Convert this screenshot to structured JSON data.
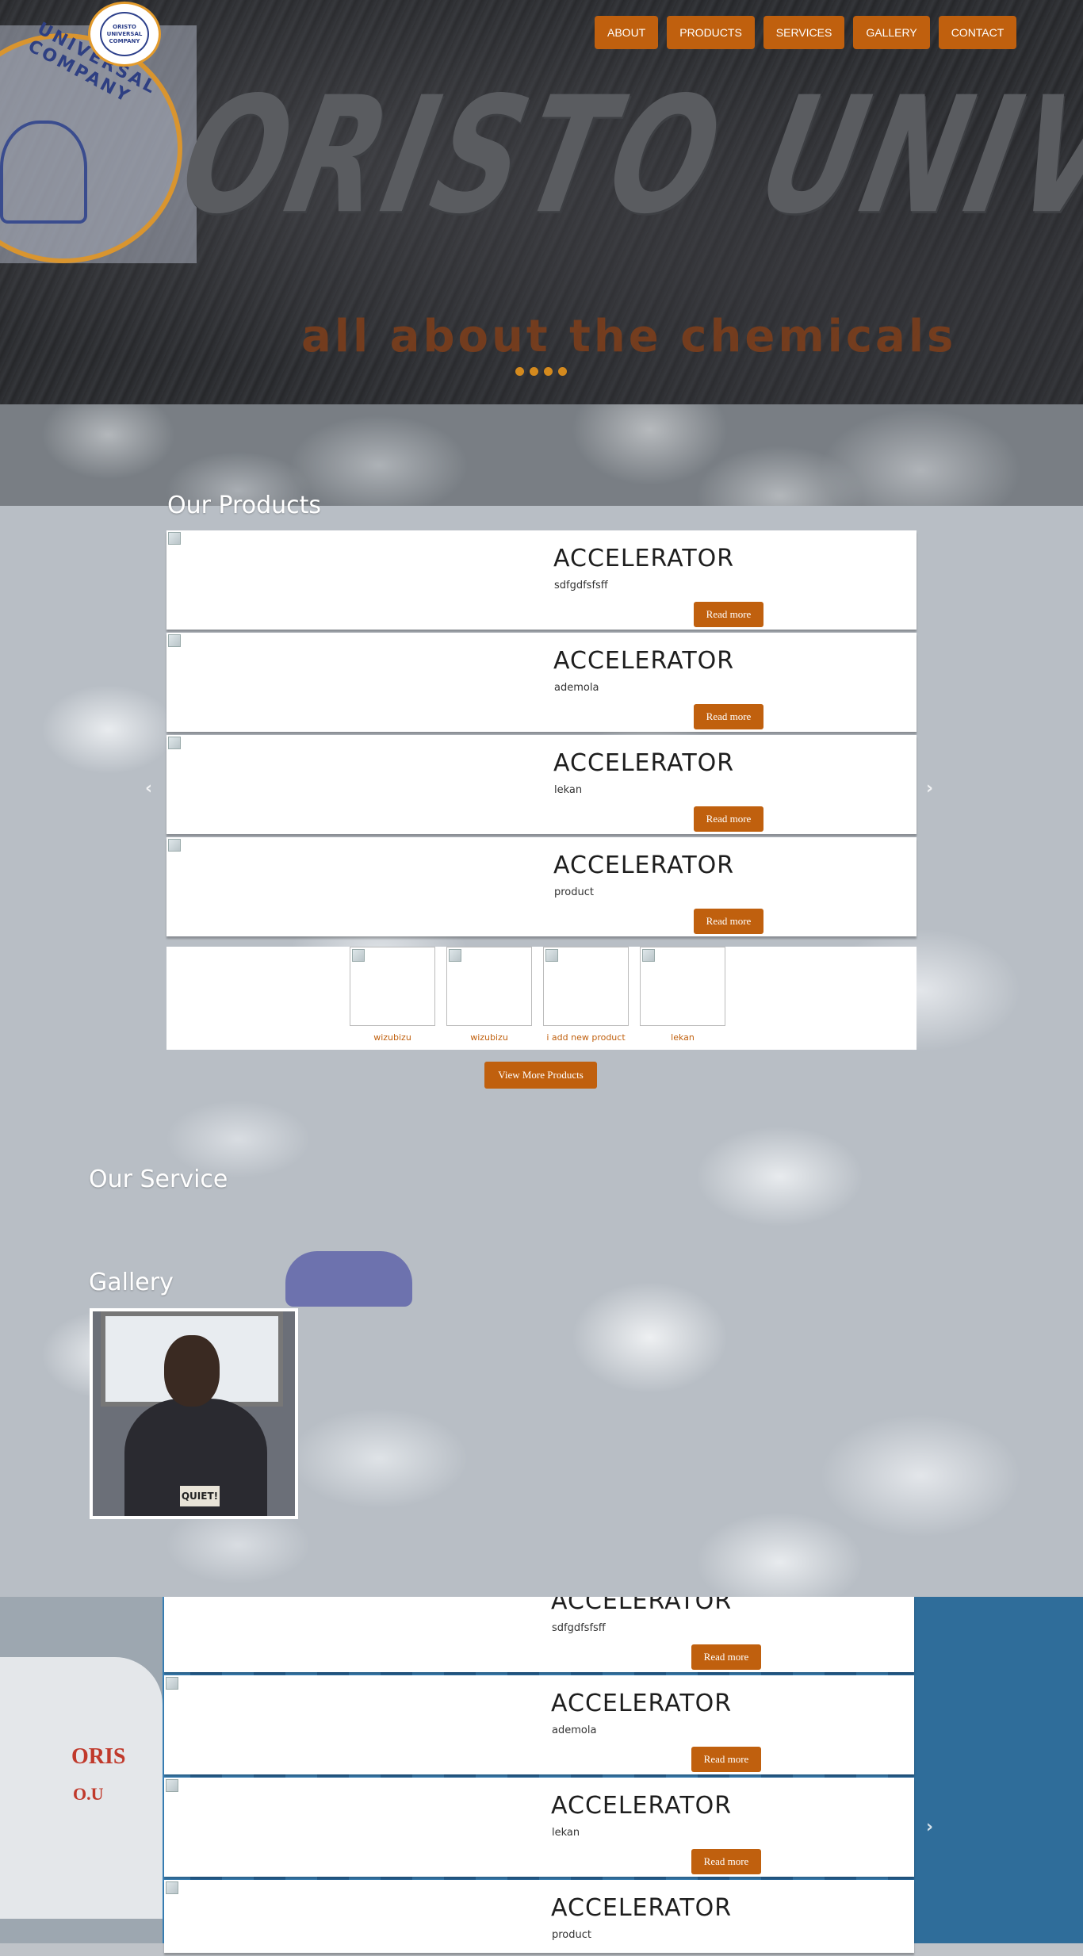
{
  "brand": {
    "logo_text": "ORISTO UNIVERSAL COMPANY",
    "hero_title": "ORISTO UNIVERSAL",
    "hero_tagline": "all about the chemicals",
    "emblem_text": "UNIVERSAL COMPANY"
  },
  "nav": [
    "ABOUT",
    "PRODUCTS",
    "SERVICES",
    "GALLERY",
    "CONTACT"
  ],
  "colors": {
    "accent": "#c0600e",
    "dot": "#d48a1e"
  },
  "sections": {
    "products_title": "Our Products",
    "service_title": "Our Service",
    "gallery_title": "Gallery"
  },
  "products": [
    {
      "name": "ACCELERATOR",
      "desc": "sdfgdfsfsff",
      "button": "Read more"
    },
    {
      "name": "ACCELERATOR",
      "desc": "ademola",
      "button": "Read more"
    },
    {
      "name": "ACCELERATOR",
      "desc": "lekan",
      "button": "Read more"
    },
    {
      "name": "ACCELERATOR",
      "desc": "product",
      "button": "Read more"
    }
  ],
  "thumbs": [
    "wizubizu",
    "wizubizu",
    "i add new product",
    "lekan"
  ],
  "view_more": "View More Products",
  "gallery_shirt_text": "QUIET!",
  "truck_text": [
    "ORIS",
    "O.U"
  ],
  "carousel_arrows": {
    "prev": "‹",
    "next": "›"
  }
}
